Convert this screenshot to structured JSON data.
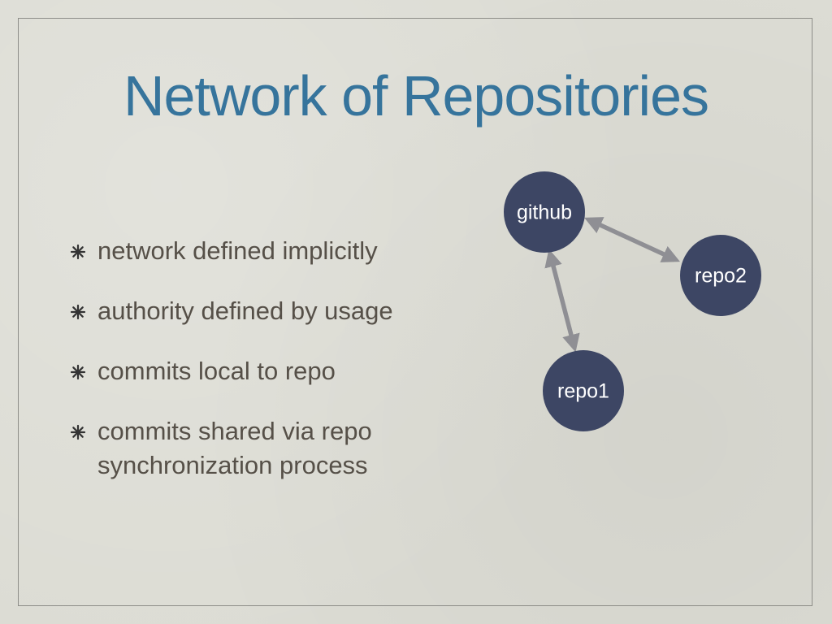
{
  "slide": {
    "title": "Network of Repositories",
    "bullets": [
      "network defined implicitly",
      "authority defined by usage",
      "commits local to repo",
      "commits shared via repo synchronization process"
    ]
  },
  "diagram": {
    "nodes": [
      {
        "id": "github",
        "label": "github"
      },
      {
        "id": "repo2",
        "label": "repo2"
      },
      {
        "id": "repo1",
        "label": "repo1"
      }
    ],
    "edges": [
      {
        "from": "github",
        "to": "repo2",
        "type": "bidirectional"
      },
      {
        "from": "github",
        "to": "repo1",
        "type": "bidirectional"
      }
    ],
    "colors": {
      "node_fill": "#3d4664",
      "arrow": "#8f8f94",
      "title": "#36749c",
      "body_text": "#565048",
      "bullet_glyph": "#333333"
    }
  }
}
